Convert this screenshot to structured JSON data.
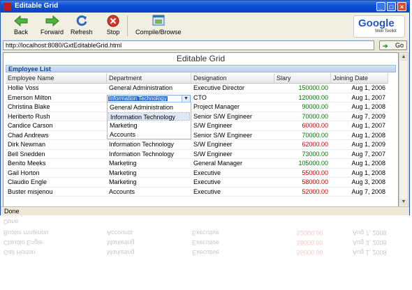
{
  "window": {
    "title": "Editable Grid"
  },
  "toolbar": {
    "back": "Back",
    "forward": "Forward",
    "refresh": "Refresh",
    "stop": "Stop",
    "compile": "Compile/Browse"
  },
  "logo": {
    "brand": "Google",
    "sub": "Web Toolkit"
  },
  "address": {
    "url": "http://localhost:8080/GxtEditableGrid.html",
    "go": "Go"
  },
  "page": {
    "heading": "Editable Grid",
    "panel_title": "Employee List"
  },
  "grid": {
    "columns": [
      "Employee Name",
      "Department",
      "Designation",
      "Slary",
      "Joining Date"
    ],
    "rows": [
      {
        "name": "Hollie Voss",
        "dept": "General Administration",
        "desig": "Executive Director",
        "salary": "150000.00",
        "date": "Aug 1, 2006",
        "sal_color": "green"
      },
      {
        "name": "Emerson Milton",
        "dept": "Information Technology",
        "desig": "CTO",
        "salary": "120000.00",
        "date": "Aug 1, 2007",
        "sal_color": "green"
      },
      {
        "name": "Christina Blake",
        "dept": "",
        "desig": "Project Manager",
        "salary": "90000.00",
        "date": "Aug 1, 2008",
        "sal_color": "green"
      },
      {
        "name": "Heriberto Rush",
        "dept": "",
        "desig": "Senior S/W Engineer",
        "salary": "70000.00",
        "date": "Aug 7, 2009",
        "sal_color": "green"
      },
      {
        "name": "Candice Carson",
        "dept": "",
        "desig": "S/W Engineer",
        "salary": "60000.00",
        "date": "Aug 1, 2007",
        "sal_color": "red"
      },
      {
        "name": "Chad Andrews",
        "dept": "",
        "desig": "Senior S/W Engineer",
        "salary": "70000.00",
        "date": "Aug 1, 2008",
        "sal_color": "green"
      },
      {
        "name": "Dirk Newman",
        "dept": "Information Technology",
        "desig": "S/W Engineer",
        "salary": "62000.00",
        "date": "Aug 1, 2009",
        "sal_color": "red"
      },
      {
        "name": "Bell Snedden",
        "dept": "Information Technology",
        "desig": "S/W Engineer",
        "salary": "73000.00",
        "date": "Aug 7, 2007",
        "sal_color": "green"
      },
      {
        "name": "Benito Meeks",
        "dept": "Marketing",
        "desig": "General Manager",
        "salary": "105000.00",
        "date": "Aug 1, 2008",
        "sal_color": "green"
      },
      {
        "name": "Gail Horton",
        "dept": "Marketing",
        "desig": "Executive",
        "salary": "55000.00",
        "date": "Aug 1, 2008",
        "sal_color": "red"
      },
      {
        "name": "Claudio Engle",
        "dept": "Marketing",
        "desig": "Executive",
        "salary": "58000.00",
        "date": "Aug 3, 2008",
        "sal_color": "red"
      },
      {
        "name": "Buster misjenou",
        "dept": "Accounts",
        "desig": "Executive",
        "salary": "52000.00",
        "date": "Aug 7, 2008",
        "sal_color": "red"
      }
    ],
    "editor_value": "Information Technology",
    "dropdown_options": [
      "General Administration",
      "Information Technology",
      "Marketing",
      "Accounts"
    ],
    "dropdown_selected": 1
  },
  "status": {
    "text": "Done"
  },
  "reflection_rows": [
    {
      "name": "Buster misjenou",
      "dept": "Accounts",
      "desig": "Executive",
      "salary": "52000.00",
      "date": "Aug 7, 2008"
    },
    {
      "name": "Claudio Engle",
      "dept": "Marketing",
      "desig": "Executive",
      "salary": "58000.00",
      "date": "Aug 3, 2008"
    },
    {
      "name": "Gail Horton",
      "dept": "Marketing",
      "desig": "Executive",
      "salary": "55000.00",
      "date": "Aug 1, 2008"
    }
  ],
  "colors": {
    "salary_green": "#007700",
    "salary_red": "#cc0000",
    "title_blue": "#0b43c2",
    "panel_text": "#15428b"
  }
}
